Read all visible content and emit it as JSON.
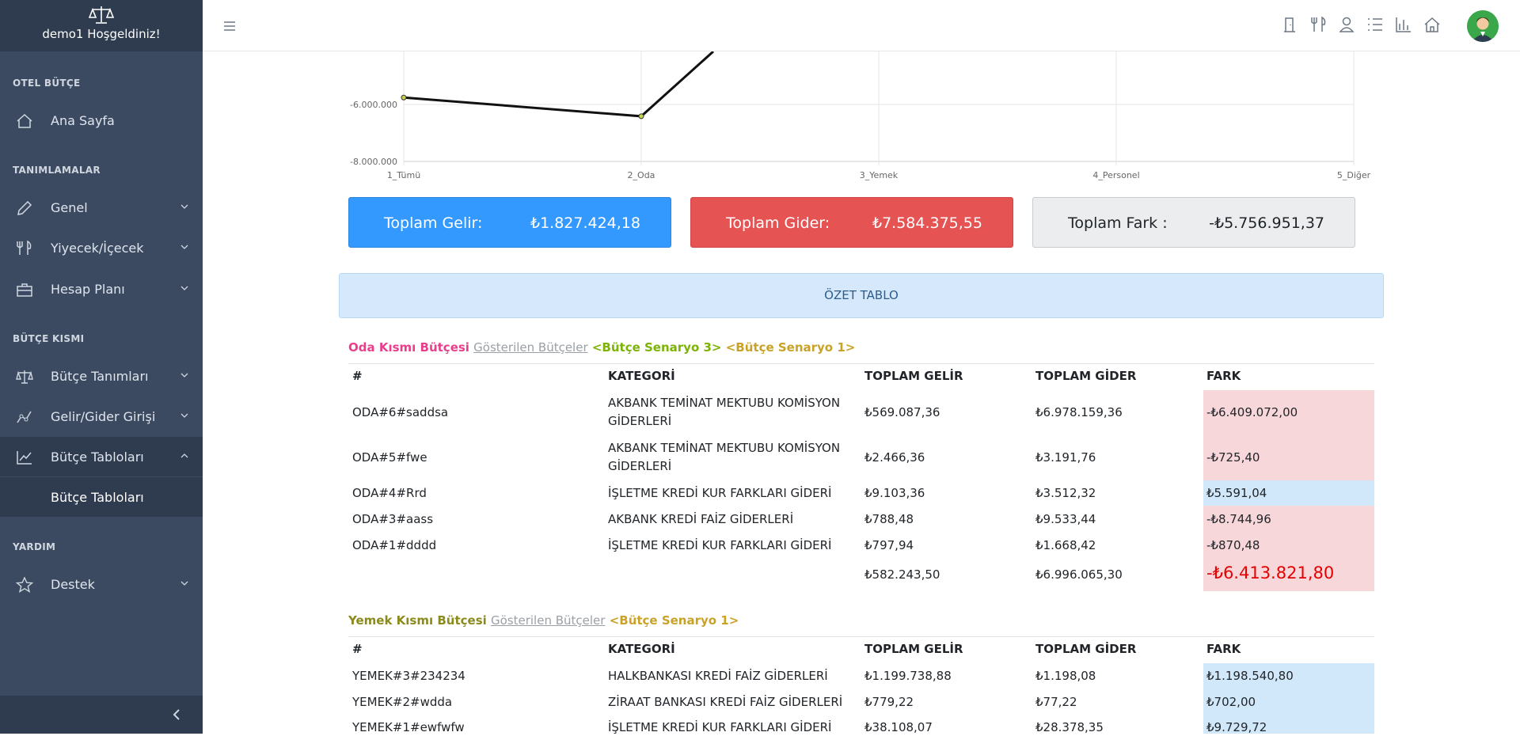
{
  "app": {
    "welcome": "demo1 Hoşgeldiniz!"
  },
  "sidebar": {
    "sections": [
      "OTEL BÜTÇE",
      "TANIMLAMALAR",
      "BÜTÇE KISMI",
      "YARDIM"
    ],
    "items": [
      {
        "label": "Ana Sayfa",
        "icon": "home-icon"
      },
      {
        "label": "Genel",
        "icon": "pencil-icon"
      },
      {
        "label": "Yiyecek/İçecek",
        "icon": "utensils-icon"
      },
      {
        "label": "Hesap Planı",
        "icon": "briefcase-icon"
      },
      {
        "label": "Bütçe Tanımları",
        "icon": "scale-icon"
      },
      {
        "label": "Gelir/Gider Girişi",
        "icon": "graph-icon"
      },
      {
        "label": "Bütçe Tabloları",
        "icon": "chart-line-icon"
      },
      {
        "label": "Destek",
        "icon": "star-icon"
      }
    ],
    "sub_item": "Bütçe Tabloları"
  },
  "chart_data": {
    "type": "line",
    "categories": [
      "1_Tümü",
      "2_Oda",
      "3_Yemek",
      "4_Personel",
      "5_Diğer"
    ],
    "y_ticks": [
      "-6.000.000",
      "-8.000.000"
    ],
    "series": [
      {
        "values": [
          -5756951.37,
          -6413821.8,
          null,
          null,
          null
        ]
      }
    ]
  },
  "cards": {
    "gelir_label": "Toplam Gelir:",
    "gelir_value": "₺1.827.424,18",
    "gider_label": "Toplam Gider:",
    "gider_value": "₺7.584.375,55",
    "fark_label": "Toplam Fark :",
    "fark_value": "-₺5.756.951,37"
  },
  "colors": {
    "gelir": "#3399ff",
    "gider": "#e55353",
    "fark": "#ebedef"
  },
  "summary_title": "ÖZET TABLO",
  "oda": {
    "title": "Oda Kısmı Bütçesi",
    "shown": "Gösterilen Bütçeler",
    "scenario1": "<Bütçe Senaryo 3>",
    "scenario2": "<Bütçe Senaryo 1>",
    "headers": [
      "#",
      "KATEGORİ",
      "TOPLAM GELİR",
      "TOPLAM GİDER",
      "FARK"
    ],
    "rows": [
      [
        "ODA#6#saddsa",
        "AKBANK TEMİNAT MEKTUBU KOMİSYON",
        "GİDERLERİ",
        "₺569.087,36",
        "₺6.978.159,36",
        "-₺6.409.072,00"
      ],
      [
        "ODA#5#fwe",
        "AKBANK TEMİNAT MEKTUBU KOMİSYON",
        "GİDERLERİ",
        "₺2.466,36",
        "₺3.191,76",
        "-₺725,40"
      ],
      [
        "ODA#4#Rrd",
        "İŞLETME KREDİ KUR FARKLARI GİDERİ",
        "",
        "₺9.103,36",
        "₺3.512,32",
        "₺5.591,04"
      ],
      [
        "ODA#3#aass",
        "AKBANK KREDİ FAİZ GİDERLERİ",
        "",
        "₺788,48",
        "₺9.533,44",
        "-₺8.744,96"
      ],
      [
        "ODA#1#dddd",
        "İŞLETME KREDİ KUR FARKLARI GİDERİ",
        "",
        "₺797,94",
        "₺1.668,42",
        "-₺870,48"
      ]
    ],
    "total_gelir": "₺582.243,50",
    "total_gider": "₺6.996.065,30",
    "total_fark": "-₺6.413.821,80"
  },
  "yemek": {
    "title": "Yemek Kısmı Bütçesi",
    "shown": "Gösterilen Bütçeler",
    "scenario": "<Bütçe Senaryo 1>",
    "headers": [
      "#",
      "KATEGORİ",
      "TOPLAM GELİR",
      "TOPLAM GİDER",
      "FARK"
    ],
    "rows": [
      [
        "YEMEK#3#234234",
        "HALKBANKASI KREDİ FAİZ GİDERLERİ",
        "₺1.199.738,88",
        "₺1.198,08",
        "₺1.198.540,80"
      ],
      [
        "YEMEK#2#wdda",
        "ZİRAAT BANKASI KREDİ FAİZ GİDERLERİ",
        "₺779,22",
        "₺77,22",
        "₺702,00"
      ],
      [
        "YEMEK#1#ewfwfw",
        "İŞLETME KREDİ KUR FARKLARI GİDERİ",
        "₺38.108,07",
        "₺28.378,35",
        "₺9.729,72"
      ]
    ]
  }
}
